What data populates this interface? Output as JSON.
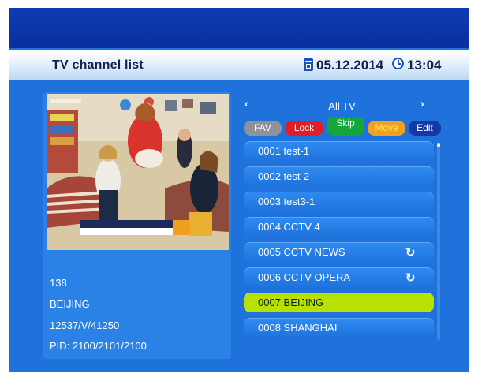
{
  "header": {
    "title": "TV channel list",
    "date": "05.12.2014",
    "time": "13:04"
  },
  "channel_info": {
    "number": "138",
    "name": "BEIJING",
    "frequency": "12537/V/41250",
    "pid": "PID: 2100/2101/2100"
  },
  "group_selector": {
    "label": "All TV",
    "prev": "‹",
    "next": "›"
  },
  "function_keys": {
    "fav": "FAV",
    "lock": "Lock",
    "skip": "Skip",
    "move": "Move",
    "edit": "Edit"
  },
  "channels": [
    {
      "label": "0001 test-1"
    },
    {
      "label": "0002 test-2"
    },
    {
      "label": "0003 test3-1"
    },
    {
      "label": "0004 CCTV 4"
    },
    {
      "label": "0005 CCTV NEWS"
    },
    {
      "label": "0006 CCTV OPERA"
    },
    {
      "label": "0007 BEIJING"
    },
    {
      "label": "0008 SHANGHAI"
    }
  ],
  "colors": {
    "background": "#1f72dc",
    "highlight": "#b8e000",
    "fav": "#8f9399",
    "lock": "#e21d25",
    "skip": "#14a63a",
    "move": "#f2a01f",
    "edit": "#1438a8"
  }
}
